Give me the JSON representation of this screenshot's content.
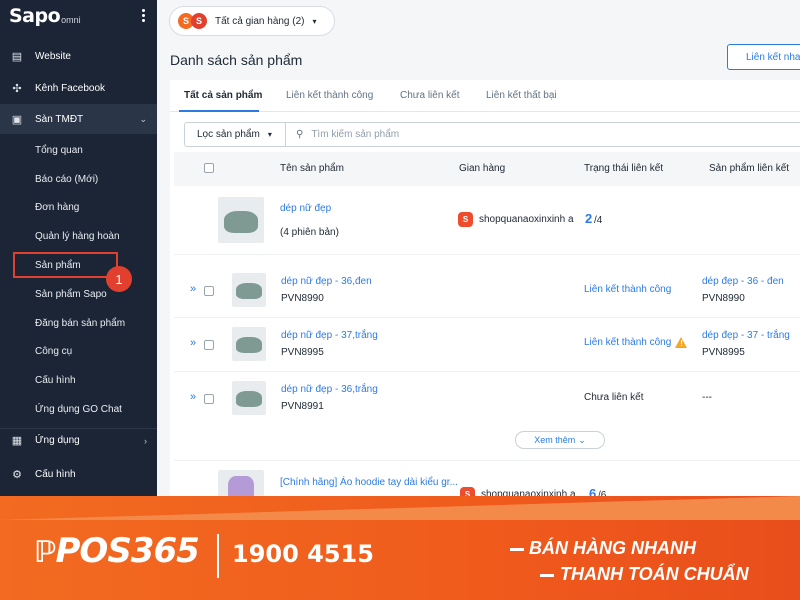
{
  "app": {
    "logo": "Sapo",
    "logo_suffix": "omni"
  },
  "sidebar": {
    "website": "Website",
    "facebook": "Kênh Facebook",
    "ecommerce": "Sàn TMĐT",
    "sub": [
      "Tổng quan",
      "Báo cáo (Mới)",
      "Đơn hàng",
      "Quản lý hàng hoàn",
      "Sản phẩm",
      "Sản phẩm Sapo",
      "Đăng bán sản phẩm",
      "Công cụ",
      "Cấu hình",
      "Ứng dụng GO Chat"
    ],
    "apps": "Ứng dụng",
    "config": "Cấu hình",
    "callout": "1"
  },
  "header": {
    "store_selector": "Tất cả gian hàng (2)"
  },
  "page": {
    "title": "Danh sách sản phẩm",
    "link_button": "Liên kết nhanh"
  },
  "tabs": [
    "Tất cả sản phẩm",
    "Liên kết thành công",
    "Chưa liên kết",
    "Liên kết thất bại"
  ],
  "filter": {
    "label": "Lọc sản phẩm",
    "search_placeholder": "Tìm kiếm sản phẩm"
  },
  "columns": [
    "Tên sản phẩm",
    "Gian hàng",
    "Trạng thái liên kết",
    "Sản phẩm liên kết"
  ],
  "products": [
    {
      "name": "dép nữ đẹp",
      "variants": "(4 phiên bản)",
      "shop": "shopquanaoxinxinh a",
      "linked": "2",
      "total": "/4"
    },
    {
      "name": "[Chính hãng] Áo hoodie tay dài kiểu gr...",
      "shop": "shopquanaoxinxinh a",
      "linked": "6",
      "total": "/6"
    }
  ],
  "variants": [
    {
      "name": "dép nữ đẹp - 36,đen",
      "sku": "PVN8990",
      "status": "Liên kết thành công",
      "linked_name": "dép đẹp - 36 - đen",
      "linked_sku": "PVN8990"
    },
    {
      "name": "dép nữ đẹp - 37,trắng",
      "sku": "PVN8995",
      "status": "Liên kết thành công",
      "warn": "!",
      "linked_name": "dép đẹp - 37 - trắng",
      "linked_sku": "PVN8995"
    },
    {
      "name": "dép nữ đẹp - 36,trắng",
      "sku": "PVN8991",
      "status": "Chưa liên kết",
      "linked_name": "---"
    }
  ],
  "see_more": "Xem thêm",
  "banner": {
    "brand": "POS365",
    "phone": "1900 4515",
    "slogan1": "BÁN HÀNG NHANH",
    "slogan2": "THANH TOÁN CHUẨN"
  },
  "colors": {
    "sidebar": "#1c2536",
    "accent": "#2c7be5",
    "highlight": "#e2402f",
    "banner": "#f26b21"
  }
}
